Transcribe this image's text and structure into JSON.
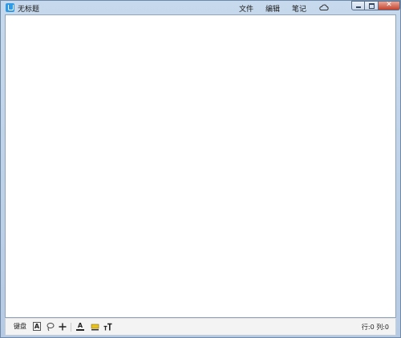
{
  "window": {
    "title": "无标题",
    "menu": [
      "文件",
      "编辑",
      "笔记"
    ]
  },
  "statusbar": {
    "keyboard_label": "键盘",
    "text_tool_label": "A",
    "underline_tool_label": "A",
    "position_row_label": "行:",
    "position_row": "0",
    "position_col_label": "列:",
    "position_col": "0"
  },
  "icons": {
    "app": "notepad-app-icon",
    "cloud": "cloud-icon",
    "lasso": "lasso-icon",
    "plus": "plus-icon",
    "highlight": "highlighter-icon",
    "font_size": "font-size-icon"
  },
  "colors": {
    "titlebar": "#c7d9ec",
    "close_button": "#c4432d",
    "highlighter": "#e7c21e"
  }
}
